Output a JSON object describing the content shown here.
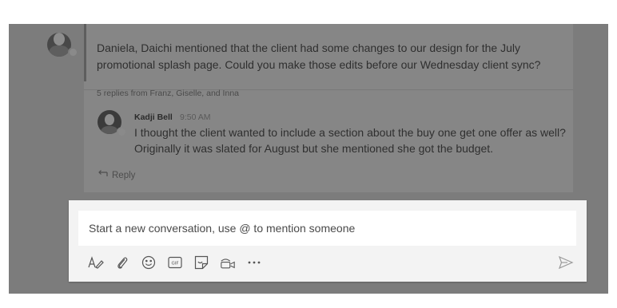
{
  "thread": {
    "post_text": "Daniela, Daichi mentioned that the client had some changes to our design for the July promotional splash page. Could you make those edits before our Wednesday client sync?",
    "replies_summary": "5 replies from Franz, Giselle, and Inna",
    "reply": {
      "author": "Kadji Bell",
      "time": "9:50 AM",
      "text": "I thought the client wanted to include a section about the buy one get one offer as well? Originally it was slated for August but she mentioned she got the budget."
    },
    "reply_action_label": "Reply"
  },
  "compose": {
    "placeholder": "Start a new conversation, use @ to mention someone",
    "toolbar_icons": [
      "format-icon",
      "attach-icon",
      "emoji-icon",
      "gif-icon",
      "sticker-icon",
      "meet-now-icon",
      "more-options-icon"
    ],
    "send_icon": "send-icon"
  },
  "colors": {
    "background_dim": "#7c7c7c",
    "thread_card": "#868686",
    "compose_bg": "#f3f3f3",
    "input_bg": "#ffffff"
  }
}
